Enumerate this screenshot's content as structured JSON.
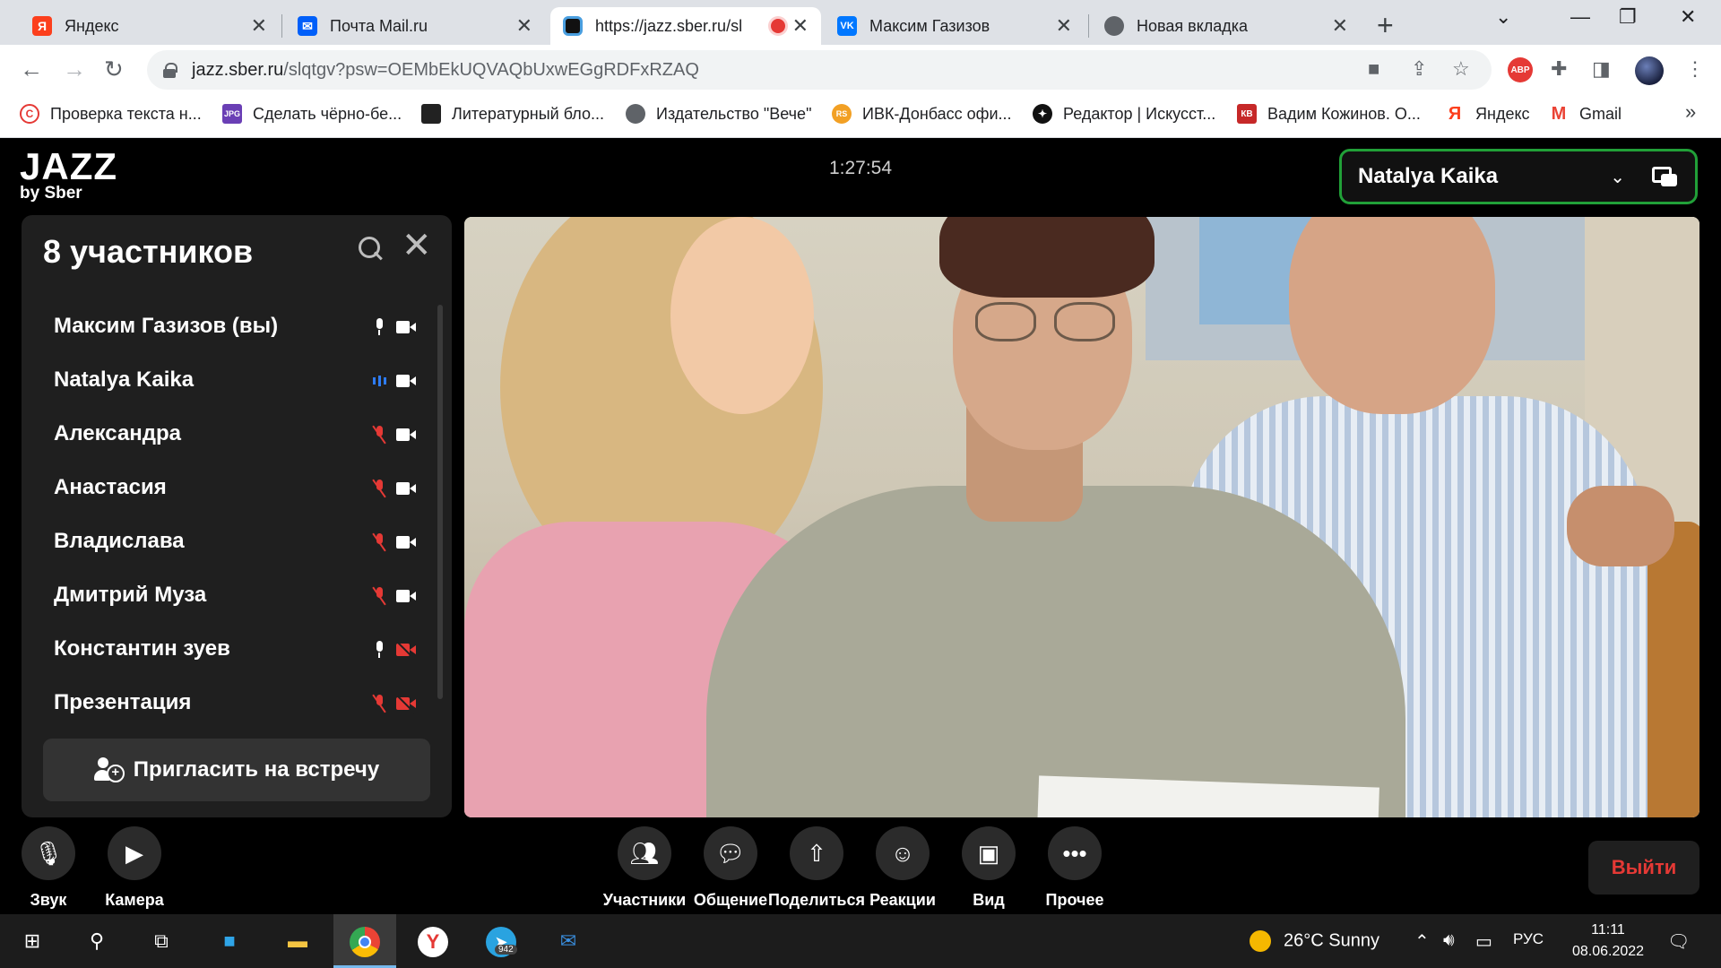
{
  "browser": {
    "tabs": [
      {
        "title": "Яндекс",
        "active": false
      },
      {
        "title": "Почта Mail.ru",
        "active": false
      },
      {
        "title": "https://jazz.sber.ru/sl",
        "active": true
      },
      {
        "title": "Максим Газизов",
        "active": false
      },
      {
        "title": "Новая вкладка",
        "active": false
      }
    ],
    "address": {
      "host": "jazz.sber.ru",
      "path": "/slqtgv?psw=OEMbEkUQVAQbUxwEGgRDFxRZAQ"
    },
    "abp_label": "ABP",
    "bookmarks": [
      {
        "label": "Проверка текста н...",
        "icon": "copyright-icon"
      },
      {
        "label": "Сделать чёрно-бе...",
        "icon": "jpg-icon"
      },
      {
        "label": "Литературный бло...",
        "icon": "dark-square-icon"
      },
      {
        "label": "Издательство \"Вече\"",
        "icon": "globe-icon"
      },
      {
        "label": "ИВК-Донбасс офи...",
        "icon": "ivk-icon"
      },
      {
        "label": "Редактор | Искусст...",
        "icon": "compass-icon"
      },
      {
        "label": "Вадим Кожинов. О...",
        "icon": "kv-icon"
      },
      {
        "label": "Яндекс",
        "icon": "yandex-icon"
      },
      {
        "label": "Gmail",
        "icon": "gmail-icon"
      }
    ]
  },
  "app": {
    "logo_main": "JAZZ",
    "logo_sub": "by Sber",
    "timer": "1:27:54",
    "speaker": "Natalya Kaika",
    "participants_title": "8 участников",
    "participants": [
      {
        "name": "Максим Газизов (вы)",
        "mic": "on",
        "cam": "on"
      },
      {
        "name": "Natalya Kaika",
        "mic": "speaking",
        "cam": "on"
      },
      {
        "name": "Александра",
        "mic": "off",
        "cam": "on"
      },
      {
        "name": "Анастасия",
        "mic": "off",
        "cam": "on"
      },
      {
        "name": "Владислава",
        "mic": "off",
        "cam": "on"
      },
      {
        "name": "Дмитрий Муза",
        "mic": "off",
        "cam": "on"
      },
      {
        "name": "Константин зуев",
        "mic": "on",
        "cam": "off"
      },
      {
        "name": "Презентация",
        "mic": "off",
        "cam": "off"
      }
    ],
    "invite_label": "Пригласить на встречу",
    "controls": {
      "sound": "Звук",
      "camera": "Камера",
      "participants": "Участники",
      "chat": "Общение",
      "share": "Поделиться",
      "reactions": "Реакции",
      "view": "Вид",
      "more": "Прочее",
      "exit": "Выйти"
    },
    "colors": {
      "accent": "#21a038",
      "danger": "#e53935",
      "speaking": "#2e7cf6"
    }
  },
  "taskbar": {
    "weather": "26°C  Sunny",
    "lang": "РУС",
    "time": "11:11",
    "date": "08.06.2022",
    "telegram_badge": "942"
  }
}
